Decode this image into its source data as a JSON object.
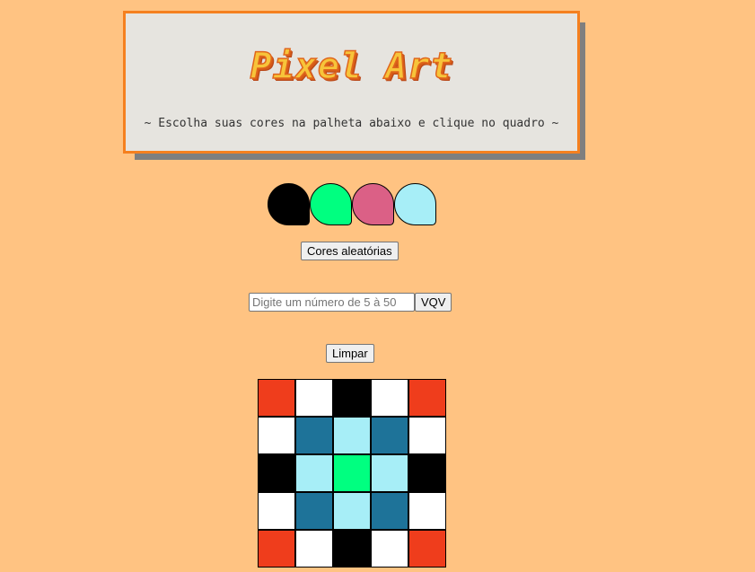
{
  "header": {
    "title": "Pixel Art",
    "subtitle": "~ Escolha suas cores na palheta abaixo e clique no quadro ~"
  },
  "palette": {
    "colors": [
      "#000000",
      "#00ff80",
      "#db6086",
      "#a7eef7"
    ]
  },
  "controls": {
    "random_label": "Cores aleatórias",
    "size_placeholder": "Digite um número de 5 à 50",
    "size_value": "",
    "vqv_label": "VQV",
    "clear_label": "Limpar"
  },
  "board": {
    "size": 5,
    "colors": {
      "red": "#ef3d1c",
      "white": "#ffffff",
      "black": "#000000",
      "teal": "#1e7399",
      "light": "#a7eef7",
      "green": "#00ff80"
    },
    "grid": [
      [
        "red",
        "white",
        "black",
        "white",
        "red"
      ],
      [
        "white",
        "teal",
        "light",
        "teal",
        "white"
      ],
      [
        "black",
        "light",
        "green",
        "light",
        "black"
      ],
      [
        "white",
        "teal",
        "light",
        "teal",
        "white"
      ],
      [
        "red",
        "white",
        "black",
        "white",
        "red"
      ]
    ]
  }
}
